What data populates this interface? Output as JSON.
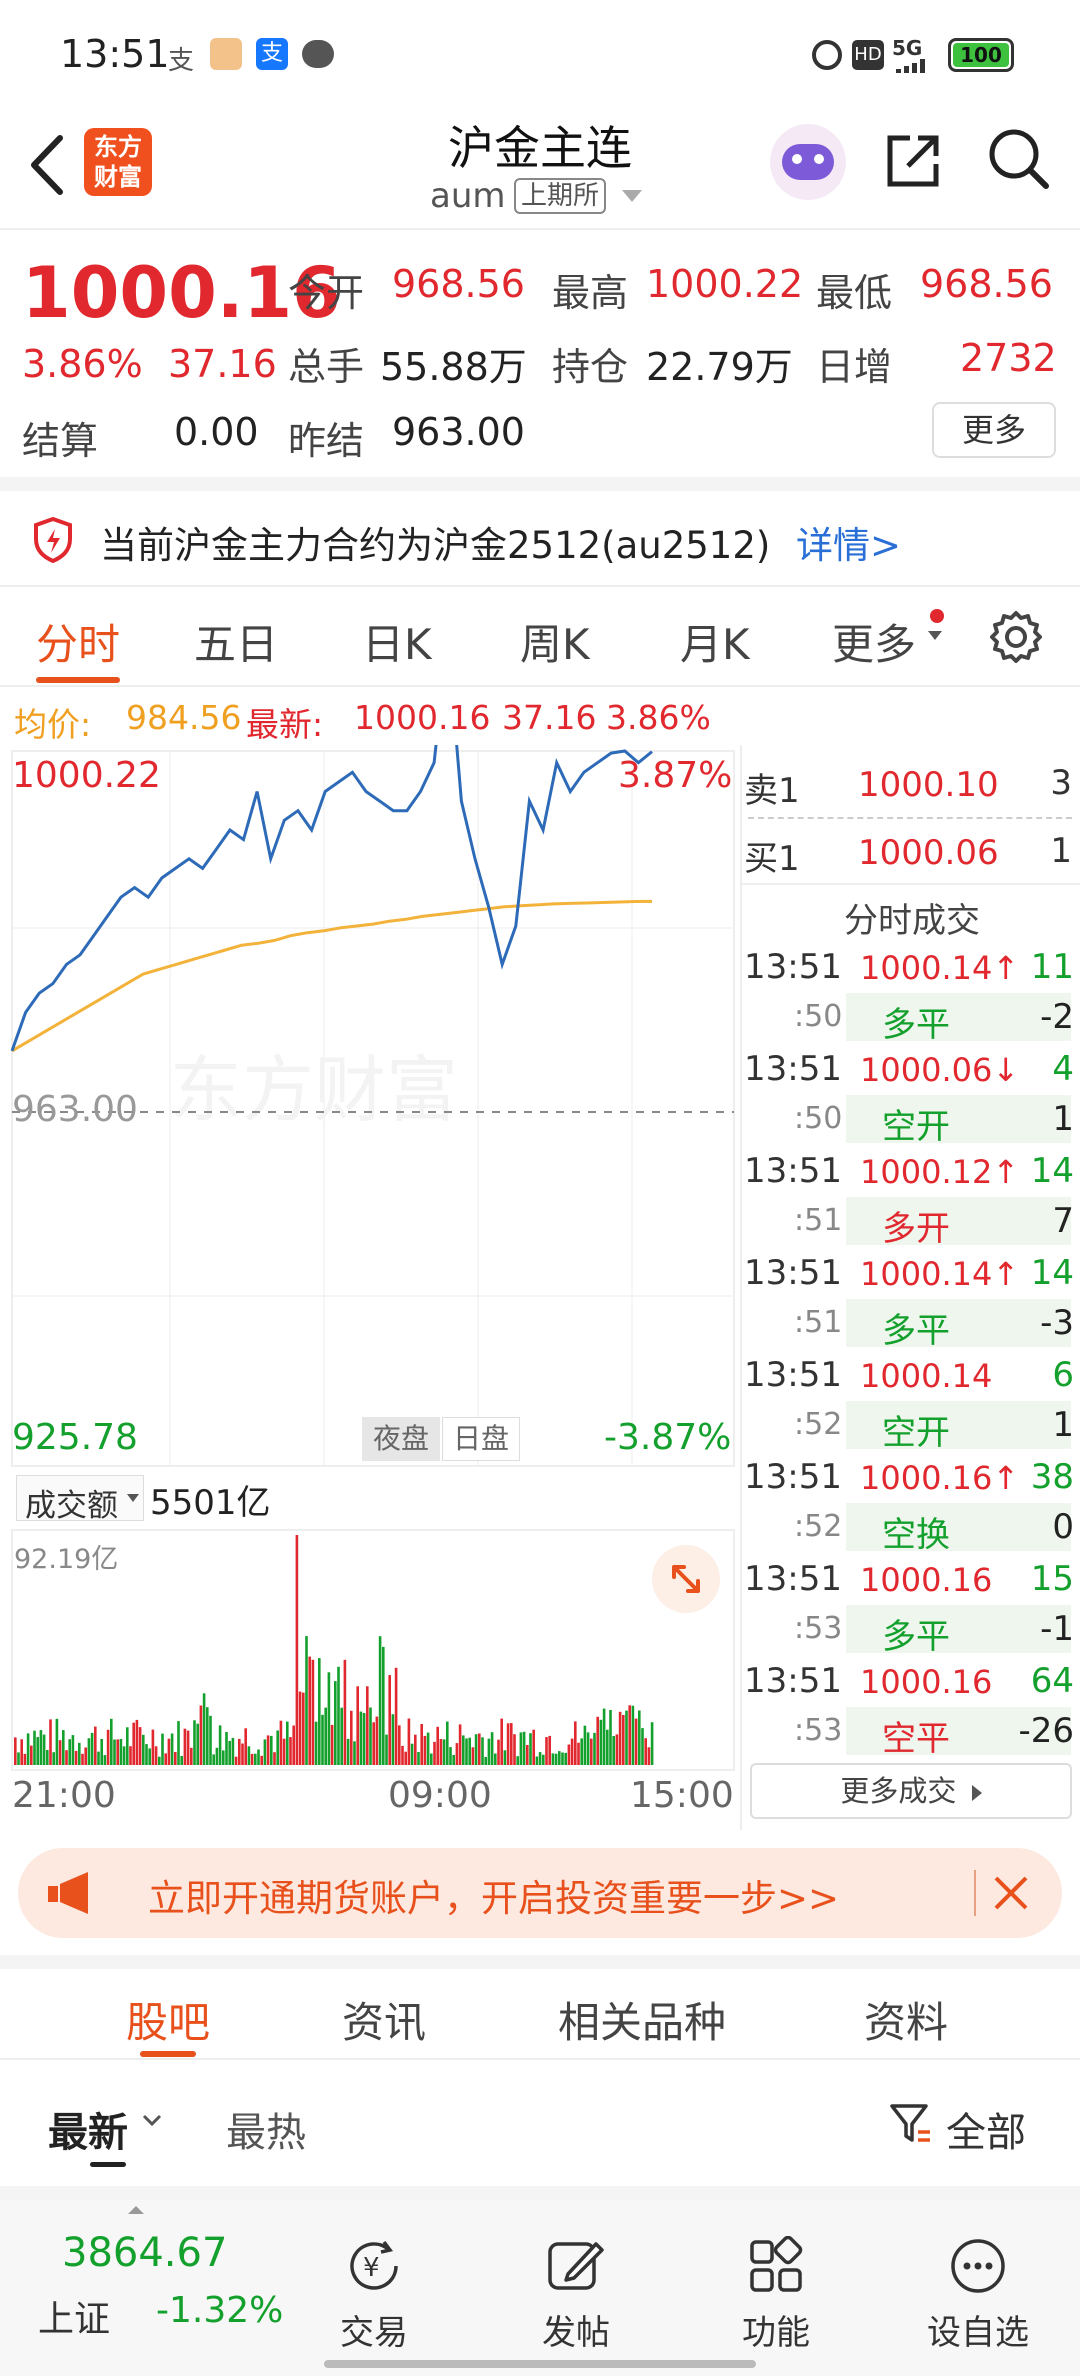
{
  "status": {
    "time": "13:51",
    "battery": "100",
    "network": "5G",
    "hd": "HD",
    "notif_icons": [
      "alipay-icon",
      "app-icon",
      "alipay-blue-icon",
      "message-icon"
    ]
  },
  "header": {
    "title": "沪金主连",
    "code": "aum",
    "exchange": "上期所",
    "logo_text": "东方财富"
  },
  "quote": {
    "price": "1000.16",
    "pct": "3.86%",
    "change": "37.16",
    "open_label": "今开",
    "open": "968.56",
    "high_label": "最高",
    "high": "1000.22",
    "low_label": "最低",
    "low": "968.56",
    "volume_label": "总手",
    "volume": "55.88万",
    "oi_label": "持仓",
    "oi": "22.79万",
    "daily_inc_label": "日增",
    "daily_inc": "2732",
    "settle_label": "结算",
    "settle": "0.00",
    "prev_settle_label": "昨结",
    "prev_settle": "963.00",
    "more_label": "更多"
  },
  "notice": {
    "text": "当前沪金主力合约为沪金2512(au2512)",
    "link": "详情>"
  },
  "tabs": [
    "分时",
    "五日",
    "日K",
    "周K",
    "月K",
    "更多"
  ],
  "chart_info": {
    "avg_label": "均价:",
    "avg": "984.56",
    "latest_label": "最新:",
    "latest": "1000.16",
    "change": "37.16",
    "pct": "3.86%"
  },
  "chart_data": {
    "type": "line",
    "y_top": "1000.22",
    "y_mid": "963.00",
    "y_bottom": "925.78",
    "pct_top": "3.87%",
    "pct_bottom": "-3.87%",
    "session_tabs": [
      "夜盘",
      "日盘"
    ],
    "watermark": "东方财富",
    "ylim": [
      925.78,
      1000.22
    ],
    "price_series": [
      969,
      973,
      975,
      976,
      978,
      979,
      981,
      983,
      985,
      986,
      985,
      987,
      988,
      989,
      988,
      990,
      992,
      991,
      996,
      989,
      993,
      994,
      992,
      996,
      997,
      998,
      996,
      995,
      994,
      994,
      996,
      999,
      1012,
      995,
      989,
      984,
      978,
      982,
      995,
      992,
      999,
      996,
      998,
      999,
      1000,
      1000.22,
      999,
      1000.16
    ],
    "avg_series": [
      969,
      970,
      971,
      972,
      973,
      974,
      975,
      976,
      977,
      977.5,
      978,
      978.5,
      979,
      979.5,
      980,
      980.2,
      980.5,
      981,
      981.3,
      981.5,
      981.8,
      982,
      982.2,
      982.5,
      982.7,
      983,
      983.2,
      983.4,
      983.6,
      983.8,
      984,
      984.1,
      984.2,
      984.3,
      984.35,
      984.4,
      984.45,
      984.5,
      984.55,
      984.56
    ],
    "volume_label": "成交额",
    "volume_total": "5501亿",
    "volume_max": "92.19亿",
    "x_ticks": [
      "21:00",
      "09:00",
      "15:00"
    ]
  },
  "orderbook": {
    "sell1_label": "卖1",
    "sell1_price": "1000.10",
    "sell1_vol": "3",
    "buy1_label": "买1",
    "buy1_price": "1000.06",
    "buy1_vol": "1",
    "title": "分时成交",
    "ticks": [
      {
        "time": "13:51",
        "sec": ":50",
        "price": "1000.14↑",
        "vol": "11",
        "kind": "多平",
        "delta": "-2",
        "pc": "red",
        "kc": "green"
      },
      {
        "time": "13:51",
        "sec": ":50",
        "price": "1000.06↓",
        "vol": "4",
        "kind": "空开",
        "delta": "1",
        "pc": "red",
        "kc": "green"
      },
      {
        "time": "13:51",
        "sec": ":51",
        "price": "1000.12↑",
        "vol": "14",
        "kind": "多开",
        "delta": "7",
        "pc": "red",
        "kc": "red"
      },
      {
        "time": "13:51",
        "sec": ":51",
        "price": "1000.14↑",
        "vol": "14",
        "kind": "多平",
        "delta": "-3",
        "pc": "red",
        "kc": "green"
      },
      {
        "time": "13:51",
        "sec": ":52",
        "price": "1000.14",
        "vol": "6",
        "kind": "空开",
        "delta": "1",
        "pc": "red",
        "kc": "green"
      },
      {
        "time": "13:51",
        "sec": ":52",
        "price": "1000.16↑",
        "vol": "38",
        "kind": "空换",
        "delta": "0",
        "pc": "red",
        "kc": "green"
      },
      {
        "time": "13:51",
        "sec": ":53",
        "price": "1000.16",
        "vol": "15",
        "kind": "多平",
        "delta": "-1",
        "pc": "red",
        "kc": "green"
      },
      {
        "time": "13:51",
        "sec": ":53",
        "price": "1000.16",
        "vol": "64",
        "kind": "空平",
        "delta": "-26",
        "pc": "red",
        "kc": "red"
      }
    ],
    "more_label": "更多成交"
  },
  "ad": {
    "text": "立即开通期货账户，开启投资重要一步>>"
  },
  "bottom_tabs": [
    "股吧",
    "资讯",
    "相关品种",
    "资料"
  ],
  "feed": {
    "latest": "最新",
    "hot": "最热",
    "filter": "全部"
  },
  "navbar": {
    "index_value": "3864.67",
    "index_name": "上证",
    "index_pct": "-1.32%",
    "items": [
      "交易",
      "发帖",
      "功能",
      "设自选"
    ]
  }
}
